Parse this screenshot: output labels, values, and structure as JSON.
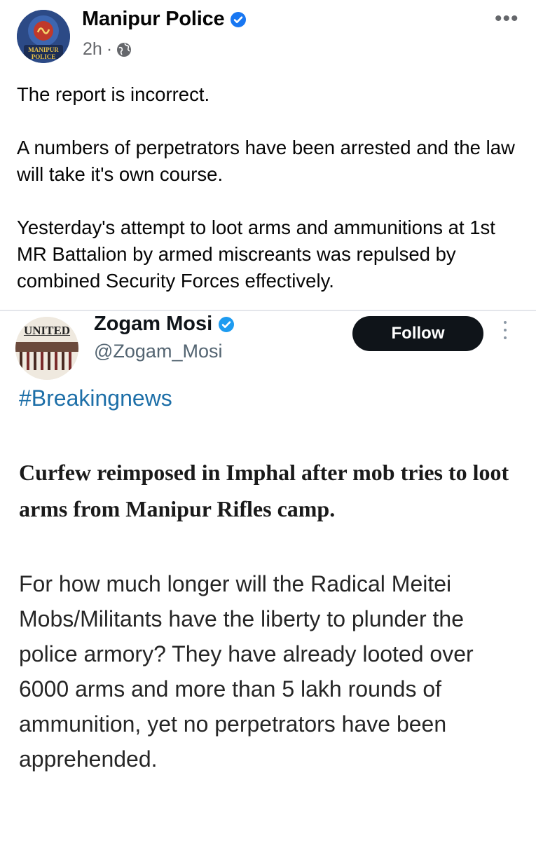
{
  "facebook_post": {
    "page_name": "Manipur Police",
    "verified": true,
    "time": "2h",
    "separator": "·",
    "privacy_icon": "globe-icon",
    "avatar_text_1": "MANIPUR",
    "avatar_text_2": "POLICE",
    "more_label": "•••",
    "paragraphs": [
      "The report is incorrect.",
      "A numbers of perpetrators have been arrested and the law will take it's own course.",
      "Yesterday's attempt to loot arms and ammunitions at 1st MR Battalion by armed miscreants was repulsed by combined Security Forces effectively."
    ]
  },
  "embedded_tweet": {
    "display_name": "Zogam Mosi",
    "verified": true,
    "handle": "@Zogam_Mosi",
    "avatar_text": "UNITED",
    "follow_label": "Follow",
    "hashtag": "#Breakingnews",
    "headline": "Curfew reimposed in Imphal after mob tries to loot arms from Manipur Rifles camp.",
    "body": "For how much longer will the Radical Meitei Mobs/Militants have the liberty to plunder the police armory? They have already looted over 6000 arms and more than 5 lakh rounds of ammunition, yet no perpetrators have been apprehended."
  },
  "colors": {
    "verified_blue": "#1877f2",
    "hashtag_blue": "#1d6fa8",
    "follow_bg": "#0f1419"
  }
}
